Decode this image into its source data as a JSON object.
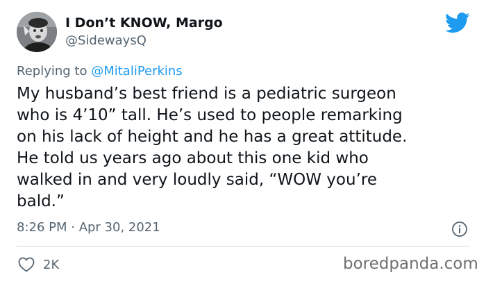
{
  "author": {
    "display_name": "I Don’t KNOW, Margo",
    "handle": "@SidewaysQ"
  },
  "reply": {
    "prefix": "Replying to ",
    "mention": "@MitaliPerkins"
  },
  "tweet_lines": [
    "My husband’s best friend is a pediatric surgeon",
    "who is 4’10” tall. He’s used to people remarking",
    "on his lack of height and he has a great attitude.",
    "He told us years ago about this one kid who",
    "walked in and very loudly said, “WOW you’re",
    "bald.”"
  ],
  "timestamp": "8:26 PM · Apr 30, 2021",
  "likes": {
    "count": "2K",
    "icon": "heart-icon"
  },
  "watermark": "boredpanda.com",
  "icons": {
    "brand": "twitter-bird-icon",
    "info": "info-icon"
  },
  "colors": {
    "twitter_blue": "#1d9bf0",
    "text": "#0f1419",
    "secondary": "#536471",
    "divider": "#cfd9de"
  }
}
